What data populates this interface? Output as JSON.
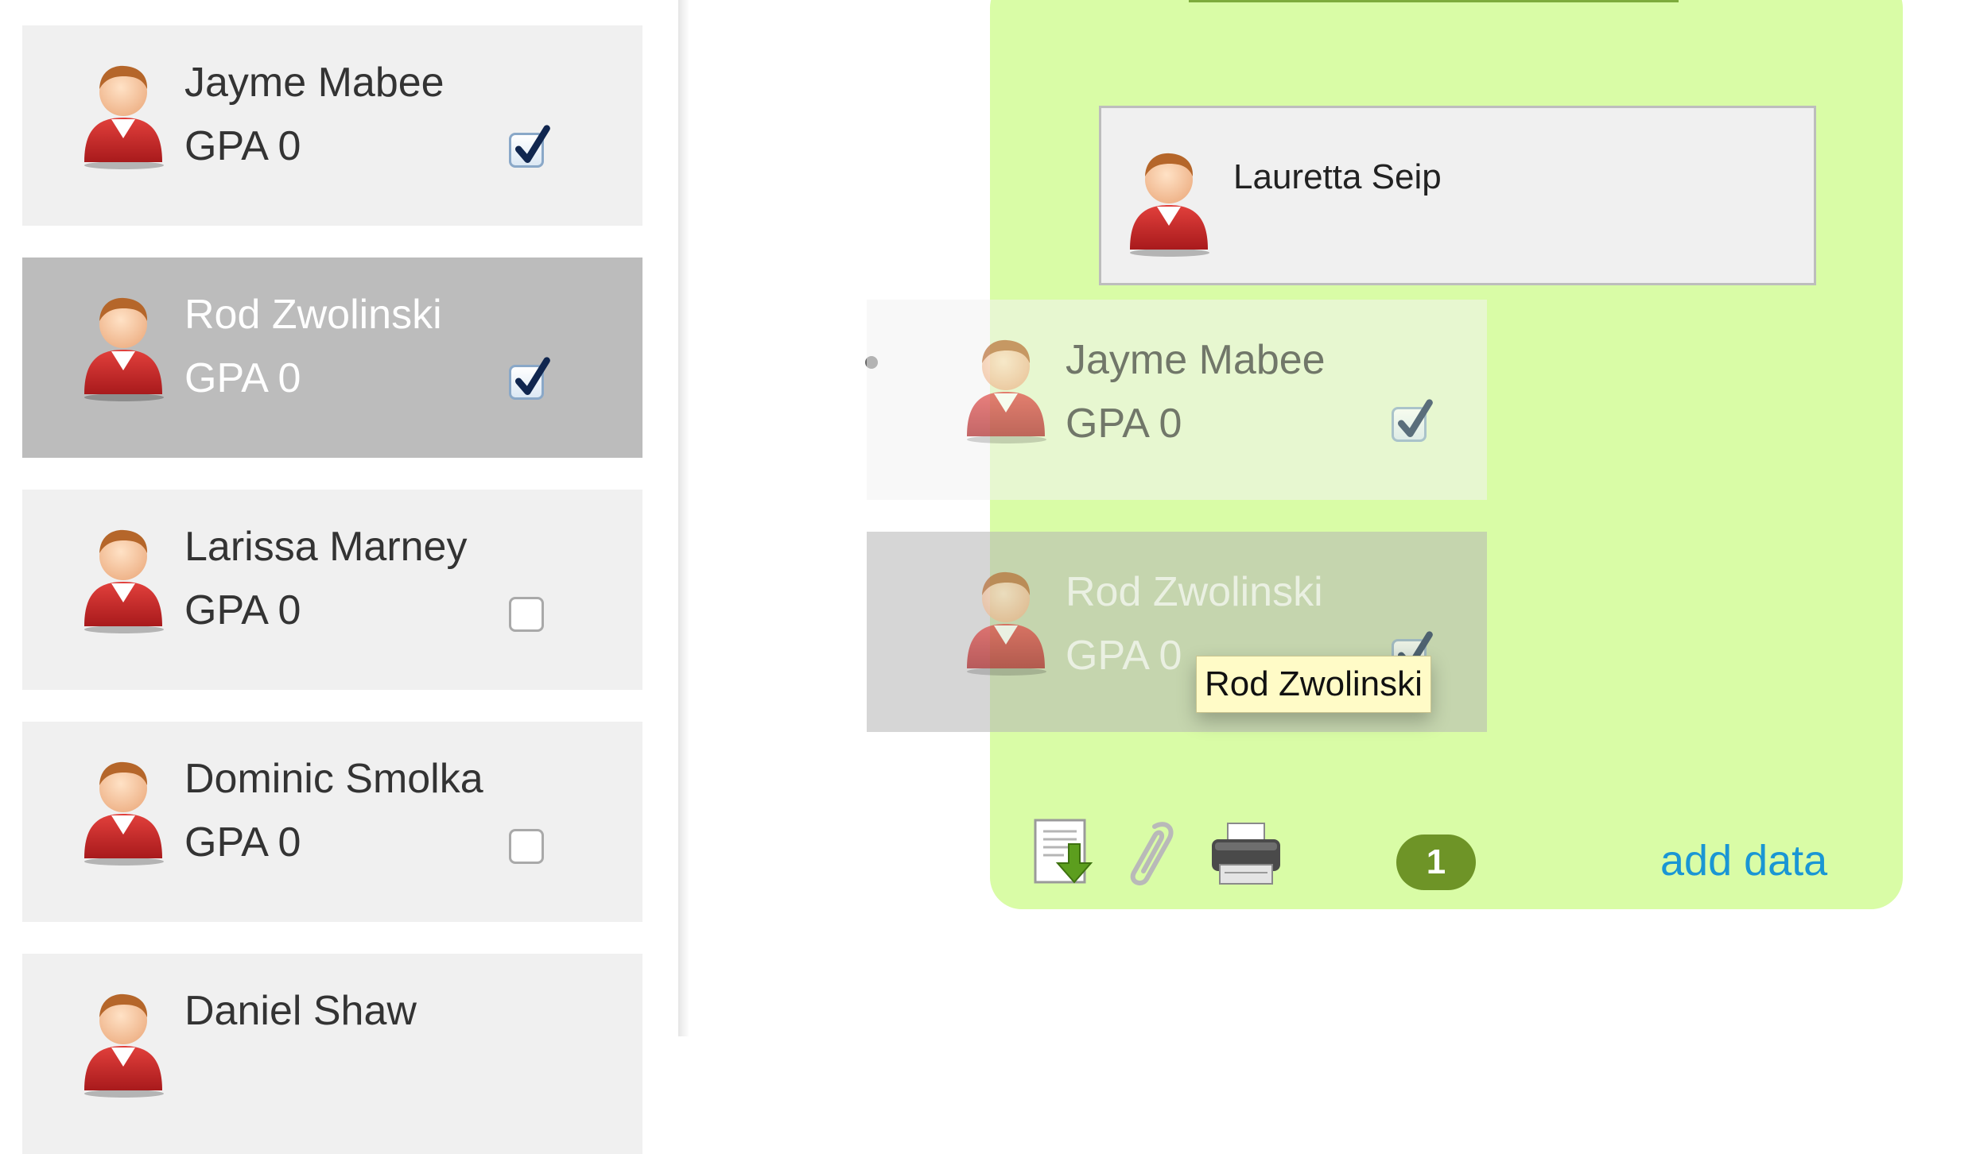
{
  "student_list": [
    {
      "name": "Jayme Mabee",
      "gpa": "GPA 0",
      "checked": true,
      "selected": false
    },
    {
      "name": "Rod Zwolinski",
      "gpa": "GPA 0",
      "checked": true,
      "selected": true
    },
    {
      "name": "Larissa Marney",
      "gpa": "GPA 0",
      "checked": false,
      "selected": false
    },
    {
      "name": "Dominic Smolka",
      "gpa": "GPA 0",
      "checked": false,
      "selected": false
    },
    {
      "name": "Daniel Shaw",
      "gpa": "",
      "checked": false,
      "selected": false
    }
  ],
  "group": {
    "member_name": "Lauretta Seip",
    "dragged": [
      {
        "name": "Jayme Mabee",
        "gpa": "GPA 0"
      },
      {
        "name": "Rod Zwolinski",
        "gpa": "GPA 0"
      }
    ],
    "tooltip": "Rod Zwolinski",
    "badge_count": "1",
    "add_data_label": "add data",
    "icons": [
      "download-document-icon",
      "paperclip-icon",
      "printer-icon"
    ]
  },
  "colors": {
    "zone_green": "#d9fca6",
    "badge_green": "#6e9427",
    "link_blue": "#1a96d4",
    "selected_gray": "#bcbcbc"
  }
}
